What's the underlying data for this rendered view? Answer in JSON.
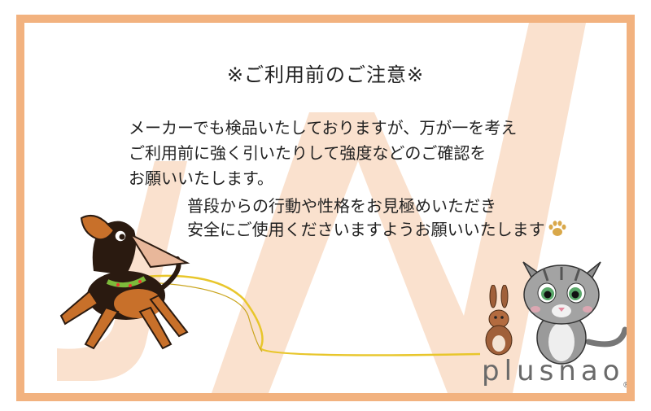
{
  "title": "※ご利用前のご注意※",
  "paragraph1": [
    "メーカーでも検品いたしておりますが、万が一を考え",
    "ご利用前に強く引いたりして強度などのご確認を",
    "お願いいたします。"
  ],
  "paragraph2": [
    "普段からの行動や性格をお見極めいただき",
    "安全にご使用くださいますようお願いいたします"
  ],
  "brand": "plusnao",
  "registered_mark": "®",
  "icons": [
    "paw-icon",
    "dog-illustration",
    "rabbit-illustration",
    "cat-illustration"
  ],
  "colors": {
    "frame": "#f2b27f",
    "watermark": "#f9dcc6",
    "text": "#222222",
    "brand": "#6a6a6a"
  }
}
